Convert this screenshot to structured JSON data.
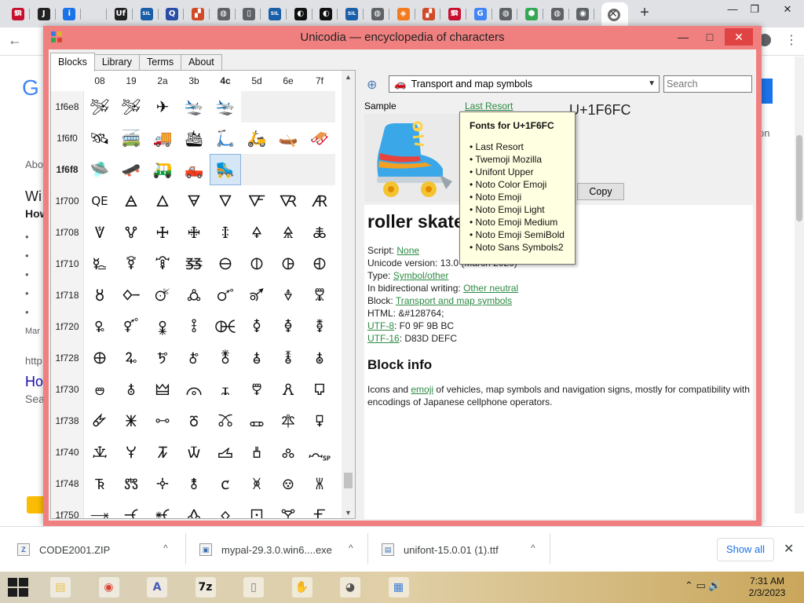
{
  "browser": {
    "tabs": [
      {
        "icon": "unicode-tab-icon",
        "glyph": "𝕸",
        "color": "#c8102e"
      },
      {
        "icon": "j-tab-icon",
        "glyph": "J",
        "color": "#222222"
      },
      {
        "icon": "info-tab-icon",
        "glyph": "i",
        "color": "#1a73e8"
      },
      {
        "icon": "blank-tab-icon",
        "glyph": "",
        "color": "#dfe1e5"
      },
      {
        "icon": "uf-tab-icon",
        "glyph": "Uf",
        "color": "#222222"
      },
      {
        "icon": "sil-tab-icon",
        "glyph": "SIL",
        "color": "#1b5fa8"
      },
      {
        "icon": "q-tab-icon",
        "glyph": "Q",
        "color": "#2a4ea5"
      },
      {
        "icon": "puzzle-tab-icon",
        "glyph": "▞",
        "color": "#d14a28"
      },
      {
        "icon": "globe-tab-icon",
        "glyph": "◍",
        "color": "#5f6368"
      },
      {
        "icon": "document-tab-icon",
        "glyph": "▯",
        "color": "#5f6368"
      },
      {
        "icon": "sil-tab-icon",
        "glyph": "SIL",
        "color": "#1b5fa8"
      },
      {
        "icon": "swirl-tab-icon",
        "glyph": "◐",
        "color": "#111111"
      },
      {
        "icon": "swirl-tab-icon",
        "glyph": "◐",
        "color": "#111111"
      },
      {
        "icon": "sil-tab-icon",
        "glyph": "SIL",
        "color": "#1b5fa8"
      },
      {
        "icon": "globe-tab-icon",
        "glyph": "◍",
        "color": "#5f6368"
      },
      {
        "icon": "diamond-tab-icon",
        "glyph": "◈",
        "color": "#f47c20"
      },
      {
        "icon": "puzzle-tab-icon",
        "glyph": "▞",
        "color": "#d14a28"
      },
      {
        "icon": "unicode-tab-icon",
        "glyph": "𝕸",
        "color": "#c8102e"
      },
      {
        "icon": "google-tab-icon",
        "glyph": "G",
        "color": "#4285f4"
      },
      {
        "icon": "globe-tab-icon",
        "glyph": "◍",
        "color": "#5f6368"
      },
      {
        "icon": "maps-tab-icon",
        "glyph": "⬢",
        "color": "#34a853"
      },
      {
        "icon": "globe-tab-icon",
        "glyph": "◍",
        "color": "#5f6368"
      },
      {
        "icon": "chrome-tab-icon",
        "glyph": "◉",
        "color": "#5f6368"
      }
    ],
    "close_glyph": "✕",
    "new_tab_glyph": "+",
    "window_buttons": {
      "minimize": "—",
      "restore": "❐",
      "close": "✕"
    },
    "back_glyph": "←",
    "menu_glyph": "⋮",
    "background_page": {
      "logo_fragment": "G",
      "side_texts": [
        "Abo",
        "Wi",
        "How",
        "•",
        "•",
        "•",
        "•",
        "•",
        "Mar",
        "http",
        "Ho",
        "Sea"
      ],
      "right_text": "on"
    }
  },
  "app": {
    "title": "Unicodia — encyclopedia of characters",
    "window_buttons": {
      "minimize": "—",
      "maximize": "□",
      "close": "✕"
    },
    "tabs": [
      "Blocks",
      "Library",
      "Terms",
      "About"
    ],
    "active_tab": "Blocks",
    "grid": {
      "columns": [
        "08",
        "19",
        "2a",
        "3b",
        "4c",
        "5d",
        "6e",
        "7f"
      ],
      "selected_column": "4c",
      "selected_row": "1f6f8",
      "rows": [
        {
          "label": "1f6e8",
          "cells": [
            "🛩",
            "🛩",
            "✈",
            "🛬",
            "🛬",
            "",
            "",
            ""
          ]
        },
        {
          "label": "1f6f0",
          "cells": [
            "🛰",
            "🚎",
            "🚚",
            "🛳",
            "🛴",
            "🛵",
            "🛶",
            "🛷"
          ]
        },
        {
          "label": "1f6f8",
          "cells": [
            "🛸",
            "🛹",
            "🛺",
            "🛻",
            "🛼",
            "",
            "",
            ""
          ]
        },
        {
          "label": "1f700",
          "cells": [
            "QE",
            "🜁",
            "🜂",
            "🜃",
            "🜄",
            "🜅",
            "🜆",
            "🜇"
          ]
        },
        {
          "label": "1f708",
          "cells": [
            "🜈",
            "🜉",
            "🜊",
            "🜋",
            "🜌",
            "🜍",
            "🜎",
            "🜏"
          ]
        },
        {
          "label": "1f710",
          "cells": [
            "🜐",
            "🜑",
            "🜒",
            "🜓",
            "🜔",
            "🜕",
            "🜖",
            "🜗"
          ]
        },
        {
          "label": "1f718",
          "cells": [
            "🜘",
            "🜙",
            "🜚",
            "🜛",
            "🜜",
            "🜝",
            "🜞",
            "🜟"
          ]
        },
        {
          "label": "1f720",
          "cells": [
            "🜠",
            "🜡",
            "🜢",
            "🜣",
            "🜤",
            "🜥",
            "🜦",
            "🜧"
          ]
        },
        {
          "label": "1f728",
          "cells": [
            "🜨",
            "🜩",
            "🜪",
            "🜫",
            "🜬",
            "🜭",
            "🜮",
            "🜯"
          ]
        },
        {
          "label": "1f730",
          "cells": [
            "🜰",
            "🜱",
            "🜲",
            "🜳",
            "🜴",
            "🜵",
            "🜶",
            "🜷"
          ]
        },
        {
          "label": "1f738",
          "cells": [
            "🜸",
            "🜹",
            "🜺",
            "🜻",
            "🜼",
            "🜽",
            "🜾",
            "🜿"
          ]
        },
        {
          "label": "1f740",
          "cells": [
            "🝀",
            "🝁",
            "🝂",
            "🝃",
            "🝄",
            "🝅",
            "🝆",
            "🝇"
          ]
        },
        {
          "label": "1f748",
          "cells": [
            "🝈",
            "🝉",
            "🝊",
            "🝋",
            "🝌",
            "🝍",
            "🝎",
            "🝏"
          ]
        },
        {
          "label": "1f750",
          "cells": [
            "🝐",
            "🝑",
            "🝒",
            "🝓",
            "🝔",
            "🝕",
            "🝖",
            "🝗"
          ]
        }
      ]
    },
    "block_selector": {
      "icon_glyph": "🚗",
      "value": "Transport and map symbols"
    },
    "search": {
      "placeholder": "Search"
    },
    "sample_label": "Sample",
    "font_link": "Last Resort",
    "codepoint": "U+1F6FC",
    "sample_glyph": "🛼",
    "copy_label": "Copy",
    "char": {
      "name": "roller skate",
      "script_label": "Script:",
      "script_value": "Non​e",
      "version_label": "Unicode version:",
      "version_value": "13.0 (March 2020)",
      "type_label": "Type:",
      "type_value": "Symbol/other",
      "bidi_label": "In bidirectional writing:",
      "bidi_value": "Other neutral",
      "block_label": "Block:",
      "block_value": "Transport and map symbols",
      "html_label": "HTML:",
      "html_value": "&#128764;",
      "utf8_label": "UTF-8",
      "utf8_value": ": F0 9F 9B BC",
      "utf16_label": "UTF-16",
      "utf16_value": ": D83D DEFC"
    },
    "block_info": {
      "title": "Block info",
      "desc_before": "Icons and ",
      "desc_link": "emoji",
      "desc_after": " of vehicles, map symbols and navigation signs, mostly for compatibility with encodings of Japanese cellphone operators."
    },
    "tooltip": {
      "title": "Fonts for U+1F6FC",
      "items": [
        "• Last Resort",
        "• Twemoji Mozilla",
        "• Unifont Upper",
        "• Noto Color Emoji",
        "• Noto Emoji",
        "• Noto Emoji Light",
        "• Noto Emoji Medium",
        "• Noto Emoji SemiBold",
        "• Noto Sans Symbols2"
      ]
    }
  },
  "downloads": {
    "items": [
      {
        "name": "CODE2001.ZIP",
        "icon": "zip-file-icon"
      },
      {
        "name": "mypal-29.3.0.win6....exe",
        "icon": "exe-file-icon"
      },
      {
        "name": "unifont-15.0.01 (1).ttf",
        "icon": "font-file-icon"
      }
    ],
    "caret": "^",
    "show_all": "Show all",
    "close_glyph": "✕"
  },
  "taskbar": {
    "apps": [
      {
        "icon": "file-explorer-icon",
        "glyph": "▤",
        "color": "#e8c04a"
      },
      {
        "icon": "chrome-icon",
        "glyph": "◉",
        "color": "#db4437"
      },
      {
        "icon": "font-app-icon",
        "glyph": "A",
        "color": "#4a5bb7"
      },
      {
        "icon": "7zip-icon",
        "glyph": "7z",
        "color": "#111111"
      },
      {
        "icon": "document-icon",
        "glyph": "▯",
        "color": "#777777"
      },
      {
        "icon": "sumatra-icon",
        "glyph": "✋",
        "color": "#c0392b"
      },
      {
        "icon": "raccoon-icon",
        "glyph": "◕",
        "color": "#555555"
      },
      {
        "icon": "unicodia-icon",
        "glyph": "▦",
        "color": "#3b7dd8"
      }
    ],
    "tray_glyphs": "⌃ ▭ 🔊",
    "time": "7:31 AM",
    "date": "2/3/2023"
  }
}
